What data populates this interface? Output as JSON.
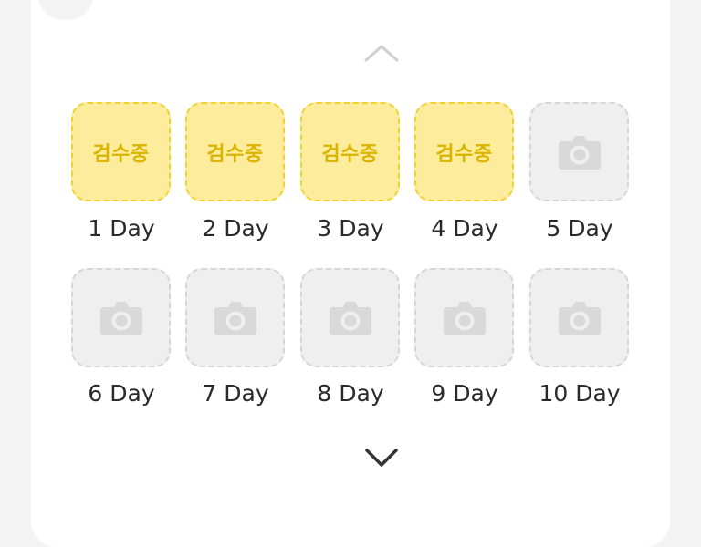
{
  "days": [
    {
      "label": "1 Day",
      "status": "검수중",
      "state": "review"
    },
    {
      "label": "2 Day",
      "status": "검수중",
      "state": "review"
    },
    {
      "label": "3 Day",
      "status": "검수중",
      "state": "review"
    },
    {
      "label": "4 Day",
      "status": "검수중",
      "state": "review"
    },
    {
      "label": "5 Day",
      "status": "",
      "state": "empty"
    },
    {
      "label": "6 Day",
      "status": "",
      "state": "empty"
    },
    {
      "label": "7 Day",
      "status": "",
      "state": "empty"
    },
    {
      "label": "8 Day",
      "status": "",
      "state": "empty"
    },
    {
      "label": "9 Day",
      "status": "",
      "state": "empty"
    },
    {
      "label": "10 Day",
      "status": "",
      "state": "empty"
    }
  ],
  "icons": {
    "empty_tile": "camera-icon",
    "scroll_up": "chevron-up-icon",
    "scroll_down": "chevron-down-icon"
  },
  "colors": {
    "review_fill": "#fcec9c",
    "review_border": "#f0d232",
    "review_text": "#dbb400",
    "empty_fill": "#efefef",
    "empty_border": "#d6d6d6",
    "camera_icon": "#d9d9d9"
  }
}
